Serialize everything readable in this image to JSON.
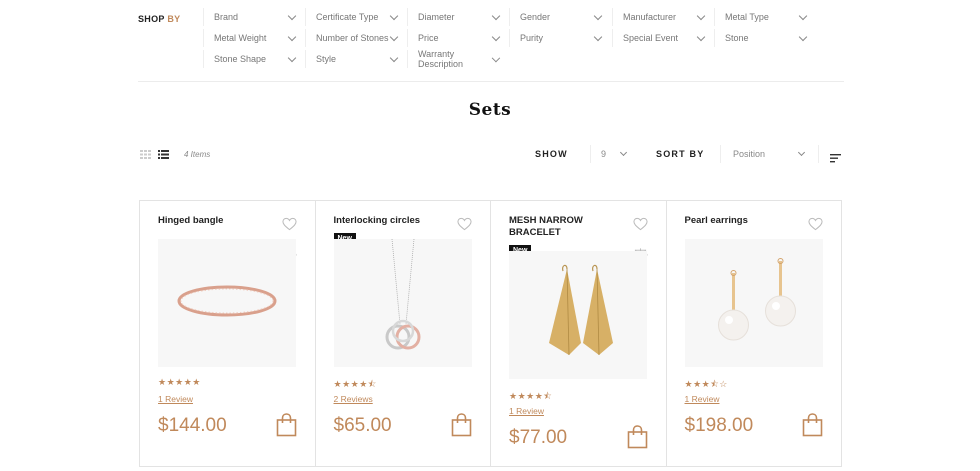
{
  "shop_by": {
    "label_main": "SHOP",
    "label_accent": "BY"
  },
  "filters": [
    "Brand",
    "Certificate Type",
    "Diameter",
    "Gender",
    "Manufacturer",
    "Metal Type",
    "Metal Weight",
    "Number of Stones",
    "Price",
    "Purity",
    "Special Event",
    "Stone",
    "Stone Shape",
    "Style",
    "Warranty Description"
  ],
  "page_title": "Sets",
  "toolbar": {
    "count": "4 Items",
    "show_label": "SHOW",
    "show_value": "9",
    "sort_label": "SORT BY",
    "sort_value": "Position"
  },
  "products": [
    {
      "name": "Hinged bangle",
      "badge": "",
      "stars": "★★★★★",
      "rating": 5,
      "reviews": "1 Review",
      "price": "$144.00"
    },
    {
      "name": "Interlocking circles",
      "badge": "New",
      "stars": "★★★★⯪",
      "rating": 4.5,
      "reviews": "2 Reviews",
      "price": "$65.00"
    },
    {
      "name": "MESH NARROW BRACELET",
      "badge": "New",
      "stars": "★★★★⯪",
      "rating": 4.5,
      "reviews": "1 Review",
      "price": "$77.00"
    },
    {
      "name": "Pearl earrings",
      "badge": "",
      "stars": "★★★⯪☆",
      "rating": 3.5,
      "reviews": "1 Review",
      "price": "$198.00"
    }
  ],
  "colors": {
    "accent": "#c0895b",
    "text": "#222222",
    "border": "#e3e3e3"
  },
  "icons": [
    "grid-view-icon",
    "list-view-icon",
    "sort-direction-icon",
    "heart-icon",
    "compare-scale-icon",
    "shopping-bag-icon"
  ]
}
